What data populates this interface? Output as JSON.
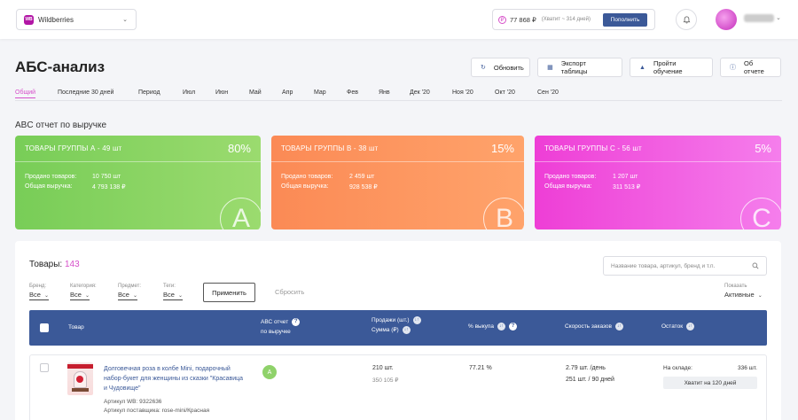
{
  "topbar": {
    "store_name": "Wildberries",
    "store_logo": "WB",
    "balance": "77 868 ₽",
    "balance_note": "(Хватит ~ 314 дней)",
    "topup_label": "Пополнить"
  },
  "page_title": "АБС-анализ",
  "toolbar": {
    "refresh": "Обновить",
    "export": "Экспорт таблицы",
    "training": "Пройти обучение",
    "about": "Об отчете"
  },
  "tabs": [
    "Общий",
    "Последние 30 дней",
    "Период",
    "Июл",
    "Июн",
    "Май",
    "Апр",
    "Мар",
    "Фев",
    "Янв",
    "Дек '20",
    "Ноя '20",
    "Окт '20",
    "Сен '20"
  ],
  "section_title": "ABC отчет по выручке",
  "cards": [
    {
      "title": "ТОВАРЫ ГРУППЫ А - 49 шт",
      "percent": "80%",
      "sold_label": "Продано товаров:",
      "sold_value": "10 750 шт",
      "revenue_label": "Общая выручка:",
      "revenue_value": "4 793 138 ₽",
      "letter": "A"
    },
    {
      "title": "ТОВАРЫ ГРУППЫ В - 38 шт",
      "percent": "15%",
      "sold_label": "Продано товаров:",
      "sold_value": "2 459 шт",
      "revenue_label": "Общая выручка:",
      "revenue_value": "928 538 ₽",
      "letter": "B"
    },
    {
      "title": "ТОВАРЫ ГРУППЫ С - 56 шт",
      "percent": "5%",
      "sold_label": "Продано товаров:",
      "sold_value": "1 207 шт",
      "revenue_label": "Общая выручка:",
      "revenue_value": "311 513 ₽",
      "letter": "C"
    }
  ],
  "products": {
    "title": "Товары:",
    "count": "143",
    "search_placeholder": "Название товара, артикул, бренд и т.п.",
    "filters": [
      {
        "label": "Бренд:",
        "value": "Все"
      },
      {
        "label": "Категория:",
        "value": "Все"
      },
      {
        "label": "Предмет:",
        "value": "Все"
      },
      {
        "label": "Теги:",
        "value": "Все"
      }
    ],
    "apply_label": "Применить",
    "reset_label": "Сбросить",
    "show_label": "Показать",
    "show_value": "Активные",
    "columns": {
      "product": "Товар",
      "abc_line1": "АВС отчет",
      "abc_line2": "по выручке",
      "sales_line1": "Продажи (шт.)",
      "sales_line2": "Сумма (₽)",
      "buyout": "% выкупа",
      "speed": "Скорость заказов",
      "stock": "Остаток"
    },
    "rows": [
      {
        "name": "Долговечная роза в колбе Mini, подарочный набор-букет для женщины из сказки \"Красавица и Чудовище\"",
        "article_wb": "Артикул WB: 9322636",
        "article_supplier": "Артикул поставщика: rose-mini/Красная",
        "grade": "A",
        "sales_qty": "210 шт.",
        "sales_sum": "350 105 ₽",
        "buyout": "77.21 %",
        "speed_day": "2.79 шт. /день",
        "speed_period": "251 шт. / 90 дней",
        "stock_label": "На складе:",
        "stock_value": "336 шт.",
        "stock_days": "Хватит на 120 дней"
      }
    ]
  },
  "colors": {
    "accent": "#d64fc9",
    "primary": "#3b5998",
    "group_a": "#7fcf5c",
    "group_b": "#fc8f58",
    "group_c": "#ef48d9"
  }
}
